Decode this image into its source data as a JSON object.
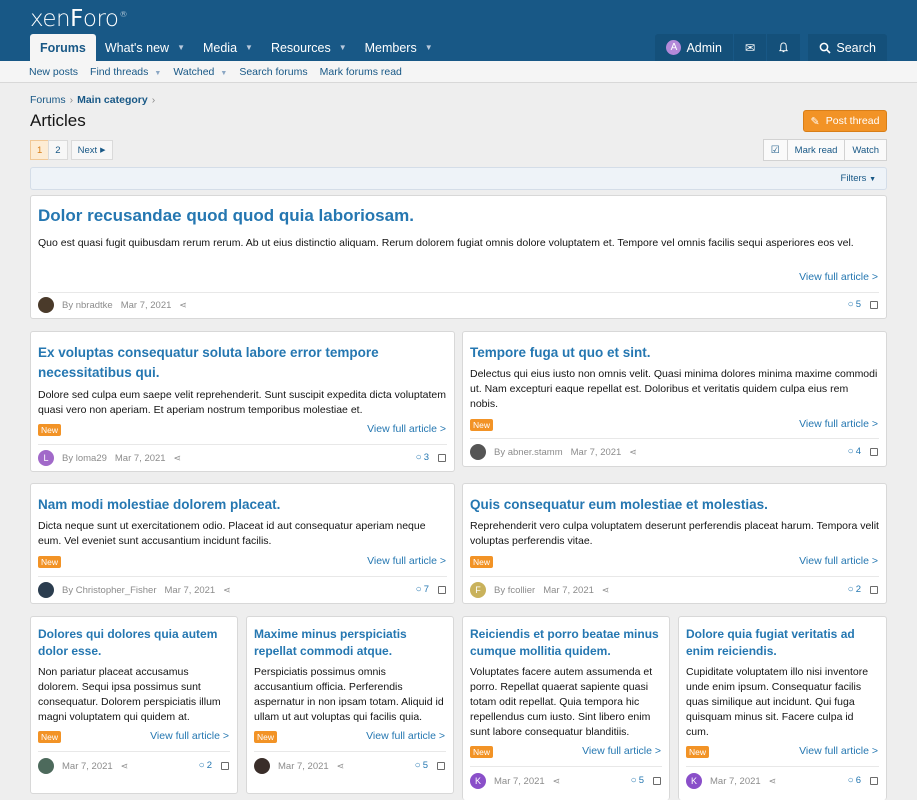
{
  "header": {
    "logo_pre": "xen",
    "logo_cap": "F",
    "logo_post": "oro",
    "logo_mark": "®",
    "tabs": [
      {
        "label": "Forums",
        "active": true
      },
      {
        "label": "What's new"
      },
      {
        "label": "Media"
      },
      {
        "label": "Resources"
      },
      {
        "label": "Members"
      }
    ],
    "user_initial": "A",
    "user_name": "Admin",
    "search_label": "Search"
  },
  "subnav": [
    "New posts",
    "Find threads",
    "Watched",
    "Search forums",
    "Mark forums read"
  ],
  "breadcrumb": {
    "root": "Forums",
    "current": "Main category"
  },
  "page_title": "Articles",
  "post_thread_label": "Post thread",
  "pager": {
    "pages": [
      "1",
      "2"
    ],
    "next": "Next"
  },
  "actions": {
    "mark_read": "Mark read",
    "watch": "Watch"
  },
  "filters_label": "Filters",
  "view_full": "View full article >",
  "new_badge": "New",
  "articles": [
    {
      "title": "Dolor recusandae quod quod quia laboriosam.",
      "body": "Quo est quasi fugit quibusdam rerum rerum. Ab ut eius distinctio aliquam. Rerum dolorem fugiat omnis dolore voluptatem et. Tempore vel omnis facilis sequi asperiores eos vel.",
      "author": "By nbradtke",
      "date": "Mar 7, 2021",
      "comments": "5",
      "new": false,
      "avatar_color": "#4a3a2a",
      "initial": ""
    },
    {
      "title": "Ex voluptas consequatur soluta labore error tempore necessitatibus qui.",
      "body": "Dolore sed culpa eum saepe velit reprehenderit. Sunt suscipit expedita dicta voluptatem quasi vero non aperiam. Et aperiam nostrum temporibus molestiae et.",
      "author": "By loma29",
      "date": "Mar 7, 2021",
      "comments": "3",
      "new": true,
      "avatar_color": "#a169c9",
      "initial": "L"
    },
    {
      "title": "Tempore fuga ut quo et sint.",
      "body": "Delectus qui eius iusto non omnis velit. Quasi minima dolores minima maxime commodi ut. Nam excepturi eaque repellat est. Doloribus et veritatis quidem culpa eius rem nobis.",
      "author": "By abner.stamm",
      "date": "Mar 7, 2021",
      "comments": "4",
      "new": true,
      "avatar_color": "#555555",
      "initial": ""
    },
    {
      "title": "Nam modi molestiae dolorem placeat.",
      "body": "Dicta neque sunt ut exercitationem odio. Placeat id aut consequatur aperiam neque eum. Vel eveniet sunt accusantium incidunt facilis.",
      "author": "By Christopher_Fisher",
      "date": "Mar 7, 2021",
      "comments": "7",
      "new": true,
      "avatar_color": "#2b3d4f",
      "initial": ""
    },
    {
      "title": "Quis consequatur eum molestiae et molestias.",
      "body": "Reprehenderit vero culpa voluptatem deserunt perferendis placeat harum. Tempora velit voluptas perferendis vitae.",
      "author": "By fcollier",
      "date": "Mar 7, 2021",
      "comments": "2",
      "new": true,
      "avatar_color": "#c9b25c",
      "initial": "F"
    },
    {
      "title": "Dolores qui dolores quia autem dolor esse.",
      "body": "Non pariatur placeat accusamus dolorem. Sequi ipsa possimus sunt consequatur. Dolorem perspiciatis illum magni voluptatem qui quidem at.",
      "author": "",
      "date": "Mar 7, 2021",
      "comments": "2",
      "new": true,
      "avatar_color": "#4d6a5c",
      "initial": ""
    },
    {
      "title": "Maxime minus perspiciatis repellat commodi atque.",
      "body": "Perspiciatis possimus omnis accusantium officia. Perferendis aspernatur in non ipsam totam. Aliquid id ullam ut aut voluptas qui facilis quia.",
      "author": "",
      "date": "Mar 7, 2021",
      "comments": "5",
      "new": true,
      "avatar_color": "#3a2e2a",
      "initial": ""
    },
    {
      "title": "Reiciendis et porro beatae minus cumque mollitia quidem.",
      "body": "Voluptates facere autem assumenda et porro. Repellat quaerat sapiente quasi totam odit repellat. Quia tempora hic repellendus cum iusto. Sint libero enim sunt labore consequatur blanditiis.",
      "author": "",
      "date": "Mar 7, 2021",
      "comments": "5",
      "new": true,
      "avatar_color": "#8a4fc9",
      "initial": "K"
    },
    {
      "title": "Dolore quia fugiat veritatis ad enim reiciendis.",
      "body": "Cupiditate voluptatem illo nisi inventore unde enim ipsum. Consequatur facilis quas similique aut incidunt. Qui fuga quisquam minus sit. Facere culpa id cum.",
      "author": "",
      "date": "Mar 7, 2021",
      "comments": "6",
      "new": true,
      "avatar_color": "#8a4fc9",
      "initial": "K"
    }
  ]
}
